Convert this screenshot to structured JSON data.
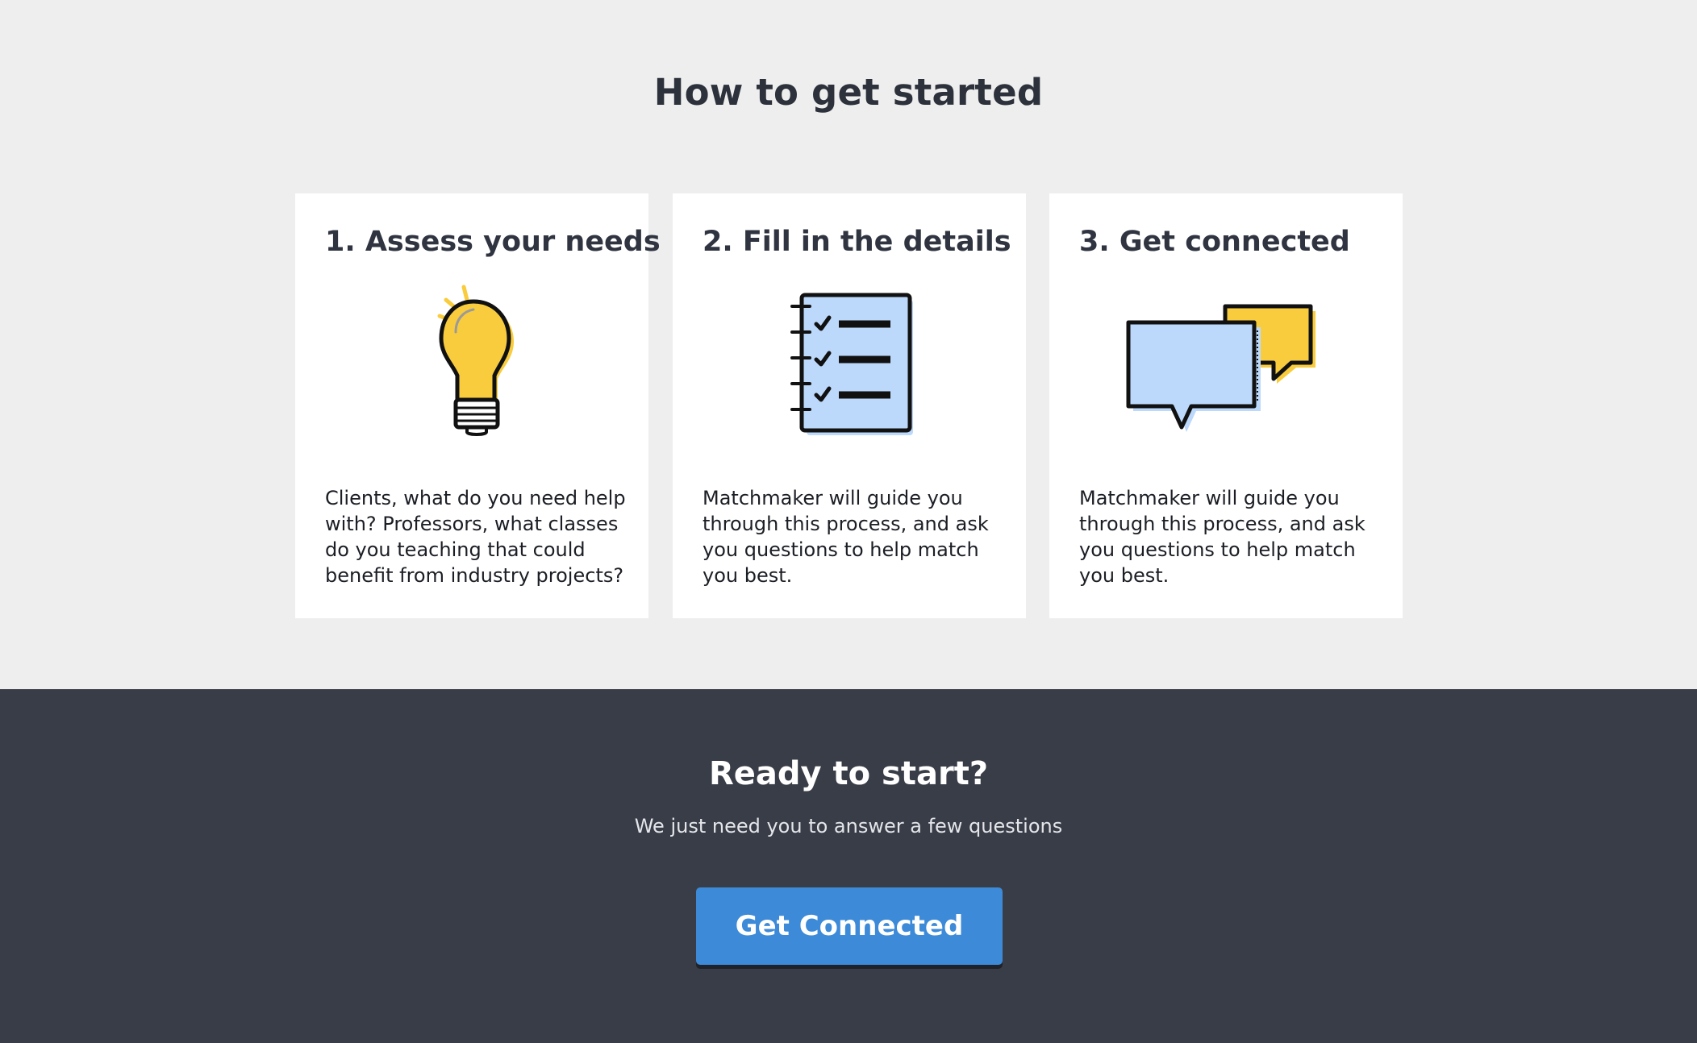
{
  "steps_section": {
    "title": "How to get started",
    "cards": [
      {
        "title": "1. Assess your needs",
        "icon": "lightbulb-icon",
        "text": "Clients, what do you need help with? Professors, what classes do you teaching that could benefit from industry projects?"
      },
      {
        "title": "2. Fill in the details",
        "icon": "checklist-notebook-icon",
        "text": "Matchmaker will guide you through this process, and ask you questions to help match you best."
      },
      {
        "title": "3. Get connected",
        "icon": "speech-bubbles-icon",
        "text": "Matchmaker will guide you through this process, and ask you questions to help match you best."
      }
    ]
  },
  "cta_section": {
    "title": "Ready to start?",
    "subtitle": "We just need you to answer a few questions",
    "button_label": "Get Connected"
  },
  "colors": {
    "page_background": "#eeeeee",
    "card_background": "#ffffff",
    "cta_background": "#393d47",
    "button": "#3c8ad8",
    "accent_yellow": "#f8cc3d",
    "accent_light_blue": "#bcd9fb"
  }
}
